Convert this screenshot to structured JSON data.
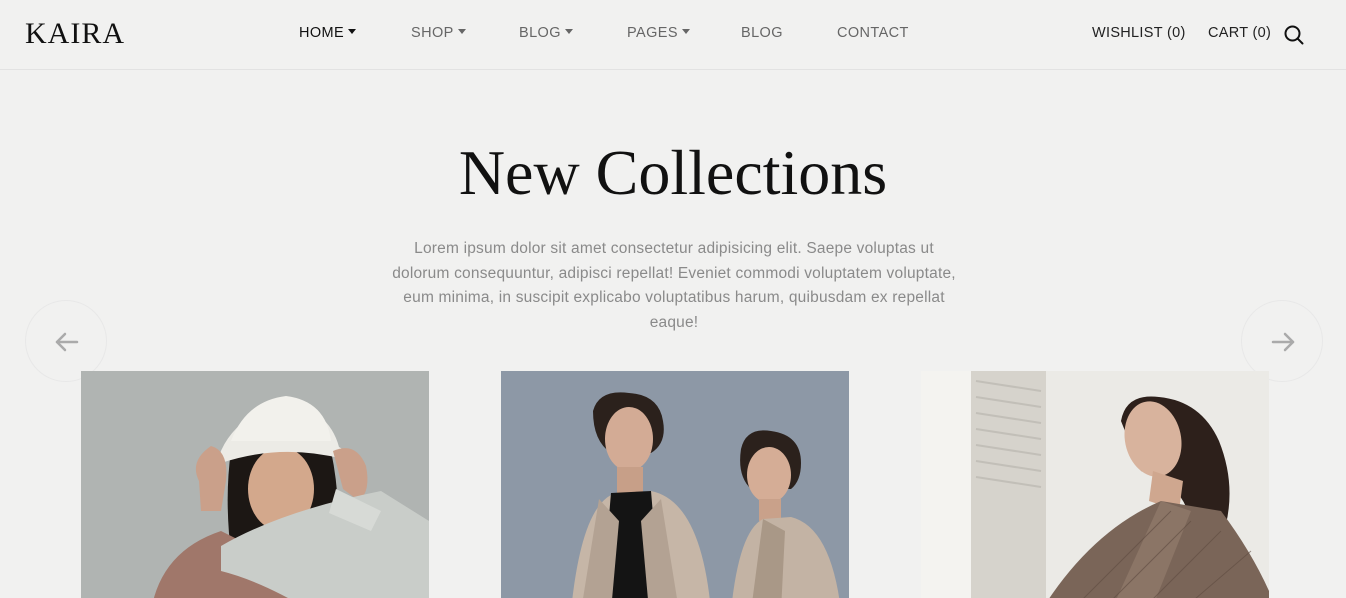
{
  "brand": {
    "logo": "KAIRA"
  },
  "nav": {
    "items": [
      {
        "label": "HOME",
        "dropdown": true,
        "active": true
      },
      {
        "label": "SHOP",
        "dropdown": true
      },
      {
        "label": "BLOG",
        "dropdown": true
      },
      {
        "label": "PAGES",
        "dropdown": true
      },
      {
        "label": "BLOG",
        "dropdown": false
      },
      {
        "label": "CONTACT",
        "dropdown": false
      }
    ]
  },
  "header_right": {
    "wishlist": "WISHLIST (0)",
    "cart": "CART (0)",
    "search_icon": "search-icon"
  },
  "hero": {
    "title": "New Collections",
    "description": "Lorem ipsum dolor sit amet consectetur adipisicing elit. Saepe voluptas ut dolorum consequuntur, adipisci repellat! Eveniet commodi voluptatem voluptate, eum minima, in suscipit explicabo voluptatibus harum, quibusdam ex repellat eaque!"
  },
  "slider": {
    "prev_icon": "arrow-left-icon",
    "next_icon": "arrow-right-icon"
  },
  "products": [
    {
      "image": "woman-white-bucket-hat-photo"
    },
    {
      "image": "two-women-trench-coats-photo"
    },
    {
      "image": "woman-plaid-blazer-photo"
    }
  ],
  "colors": {
    "background": "#f1f1f0",
    "text_dark": "#111111",
    "text_muted": "#8a8a8a"
  }
}
